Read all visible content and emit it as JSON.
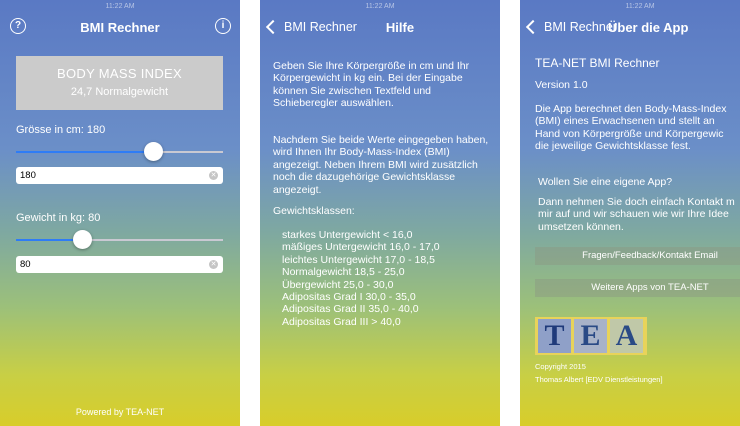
{
  "status": {
    "time": "11:22 AM"
  },
  "screen1": {
    "title": "BMI Rechner",
    "help_icon": "?",
    "info_icon": "i",
    "bmi_heading": "BODY MASS INDEX",
    "bmi_result": "24,7 Normalgewicht",
    "height_label": "Grösse in cm: 180",
    "height_value": "180",
    "height_slider_fraction": 0.66,
    "weight_label": "Gewicht in kg: 80",
    "weight_value": "80",
    "weight_slider_fraction": 0.32,
    "powered_by": "Powered by TEA-NET",
    "accent_color": "#2e7cf6"
  },
  "screen2": {
    "back_label": "BMI Rechner",
    "title": "Hilfe",
    "para1": "Geben Sie Ihre Körpergröße in cm und Ihr Körpergewicht in kg ein. Bei der Eingabe können Sie zwischen Textfeld und Schieberegler auswählen.",
    "para2": "Nachdem Sie beide Werte eingegeben haben, wird Ihnen Ihr Body-Mass-Index (BMI) angezeigt. Neben Ihrem BMI wird zusätzlich noch die dazugehörige Gewichtsklasse angezeigt.",
    "classes_heading": "Gewichtsklassen:",
    "classes": [
      "starkes Untergewicht < 16,0",
      "mäßiges Untergewicht 16,0 - 17,0",
      "leichtes Untergewicht 17,0 - 18,5",
      "Normalgewicht 18,5 - 25,0",
      "Übergewicht 25,0 - 30,0",
      "Adipositas Grad I 30,0 - 35,0",
      "Adipositas Grad II 35,0 - 40,0",
      "Adipositas Grad III > 40,0"
    ]
  },
  "screen3": {
    "back_label": "BMI Rechner",
    "title": "Über die App",
    "app_name": "TEA-NET BMI Rechner",
    "version": "Version 1.0",
    "description": "Die App berechnet den Body-Mass-Index\n(BMI) eines Erwachsenen und stellt an\nHand von Körpergröße und Körpergewic\ndie jeweilige Gewichtsklasse fest.",
    "own_app_heading": "Wollen Sie eine eigene App?",
    "own_app_text": "Dann nehmen Sie doch einfach Kontakt m\nmir auf und wir schauen wie wir Ihre Idee\numsetzen können.",
    "contact_button": "Fragen/Feedback/Kontakt Email",
    "more_apps_button": "Weitere Apps von TEA-NET",
    "logo_letters": [
      "T",
      "E",
      "A"
    ],
    "copyright": "Copyright 2015",
    "author": "Thomas Albert [EDV Dienstleistungen]"
  }
}
